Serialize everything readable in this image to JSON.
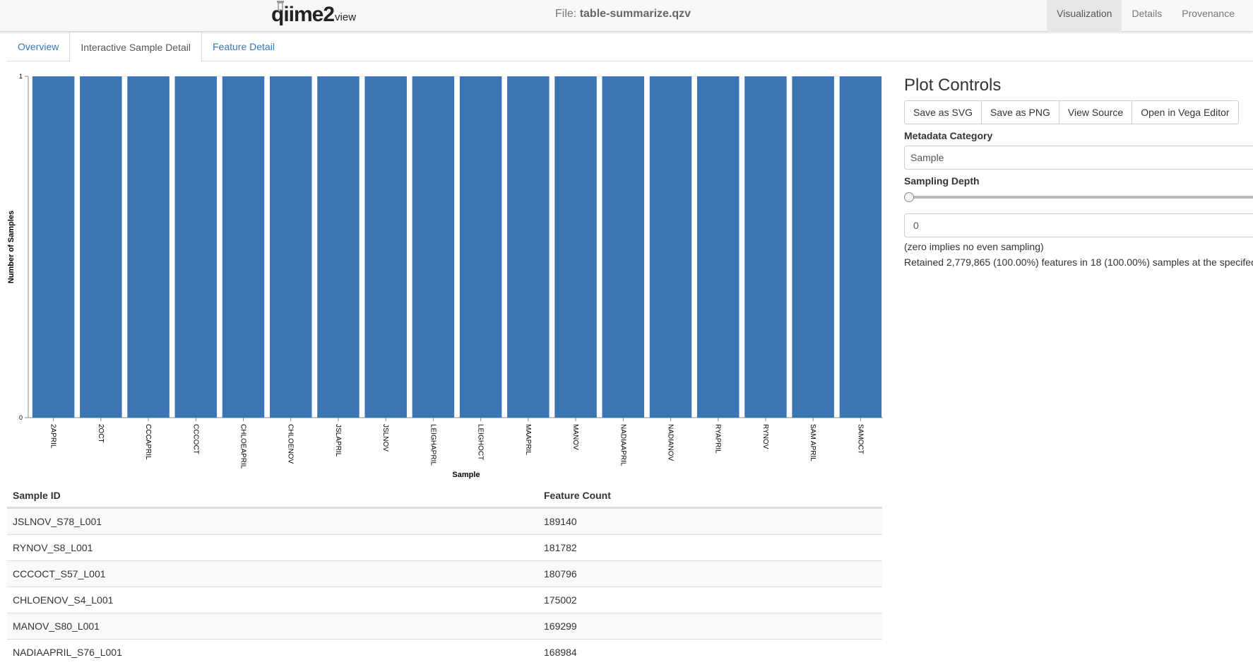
{
  "navbar": {
    "logo_main": "qiime2",
    "logo_sub": "view",
    "file_prefix": "File:",
    "file_name": "table-summarize.qzv",
    "links": [
      "Visualization",
      "Details",
      "Provenance"
    ]
  },
  "tabs": [
    "Overview",
    "Interactive Sample Detail",
    "Feature Detail"
  ],
  "chart_data": {
    "type": "bar",
    "xlabel": "Sample",
    "ylabel": "Number of Samples",
    "ylim": [
      0,
      1
    ],
    "yticks": [
      "0",
      "1"
    ],
    "categories": [
      "2APRIL",
      "2OCT",
      "CCCAPRIL",
      "CCCOCT",
      "CHLOEAPRIL",
      "CHLOENOV",
      "JSLAPRIL",
      "JSLNOV",
      "LEIGHAPRIL",
      "LEIGHOCT",
      "MAAPRIL",
      "MANOV",
      "NADIAAPRIL",
      "NADIANOV",
      "RYAPRIL",
      "RYNOV",
      "SAM APRIL",
      "SAMOCT"
    ],
    "values": [
      1,
      1,
      1,
      1,
      1,
      1,
      1,
      1,
      1,
      1,
      1,
      1,
      1,
      1,
      1,
      1,
      1,
      1
    ],
    "color": "#3b75b4"
  },
  "table": {
    "headers": [
      "Sample ID",
      "Feature Count"
    ],
    "rows": [
      [
        "JSLNOV_S78_L001",
        "189140"
      ],
      [
        "RYNOV_S8_L001",
        "181782"
      ],
      [
        "CCCOCT_S57_L001",
        "180796"
      ],
      [
        "CHLOENOV_S4_L001",
        "175002"
      ],
      [
        "MANOV_S80_L001",
        "169299"
      ],
      [
        "NADIAAPRIL_S76_L001",
        "168984"
      ]
    ]
  },
  "controls": {
    "title": "Plot Controls",
    "buttons": [
      "Save as SVG",
      "Save as PNG",
      "View Source",
      "Open in Vega Editor"
    ],
    "metadata_label": "Metadata Category",
    "metadata_value": "Sample",
    "depth_label": "Sampling Depth",
    "depth_level": 0,
    "depth_value": "0",
    "note": "(zero implies no even sampling)",
    "retained": "Retained 2,779,865 (100.00%) features in 18 (100.00%) samples at the specifed"
  }
}
